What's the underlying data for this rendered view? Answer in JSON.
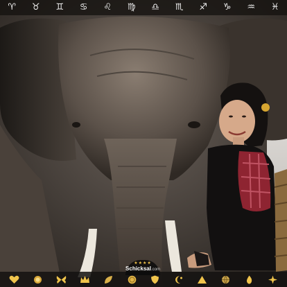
{
  "zodiac_bar": {
    "signs": [
      {
        "glyph": "♈",
        "name": "aries"
      },
      {
        "glyph": "♉",
        "name": "taurus"
      },
      {
        "glyph": "♊",
        "name": "gemini"
      },
      {
        "glyph": "♋",
        "name": "cancer"
      },
      {
        "glyph": "♌",
        "name": "leo"
      },
      {
        "glyph": "♍",
        "name": "virgo"
      },
      {
        "glyph": "♎",
        "name": "libra"
      },
      {
        "glyph": "♏",
        "name": "scorpio"
      },
      {
        "glyph": "♐",
        "name": "sagittarius"
      },
      {
        "glyph": "♑",
        "name": "capricorn"
      },
      {
        "glyph": "♒",
        "name": "aquarius"
      },
      {
        "glyph": "♓",
        "name": "pisces"
      }
    ]
  },
  "brand": {
    "name": "Schicksal",
    "domain": ".com",
    "stars": "★★★★"
  },
  "bottom_bar": {
    "icons": [
      "heart-icon",
      "lion-icon",
      "butterfly-icon",
      "crown-icon",
      "leaf-icon",
      "coin-icon",
      "shield-icon",
      "moon-star-icon",
      "triangle-icon",
      "globe-icon",
      "flame-icon",
      "sparkle-icon"
    ],
    "accent_color": "#f0c44c"
  },
  "photo": {
    "subject": "elephant-with-woman-photo"
  }
}
